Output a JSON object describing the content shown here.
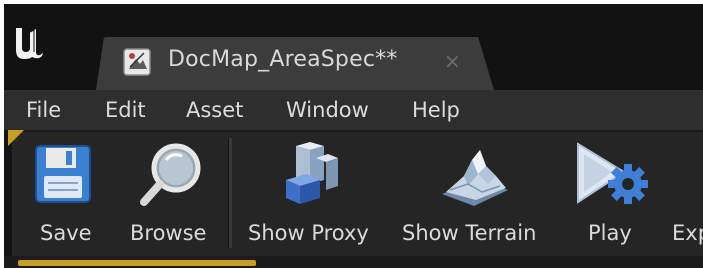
{
  "app": {
    "logo_icon": "unreal-engine-logo-icon"
  },
  "tab": {
    "title": "DocMap_AreaSpec**",
    "icon": "map-level-icon",
    "close_icon": "close-icon",
    "close_glyph": "×"
  },
  "menu": {
    "items": [
      {
        "label": "File"
      },
      {
        "label": "Edit"
      },
      {
        "label": "Asset"
      },
      {
        "label": "Window"
      },
      {
        "label": "Help"
      }
    ]
  },
  "toolbar": {
    "buttons": [
      {
        "label": "Save",
        "icon": "floppy-disk-icon"
      },
      {
        "label": "Browse",
        "icon": "magnifying-glass-icon"
      },
      {
        "label": "Show Proxy",
        "icon": "proxy-blocks-icon"
      },
      {
        "label": "Show Terrain",
        "icon": "terrain-mountain-icon"
      },
      {
        "label": "Play",
        "icon": "play-gear-icon"
      },
      {
        "label": "Exp",
        "icon": "export-icon"
      }
    ]
  },
  "colors": {
    "background": "#141414",
    "tab": "#3c3c3c",
    "menubar": "#2e2e2e",
    "toolbar": "#252525",
    "accent": "#c79e23",
    "text": "#dadada"
  }
}
